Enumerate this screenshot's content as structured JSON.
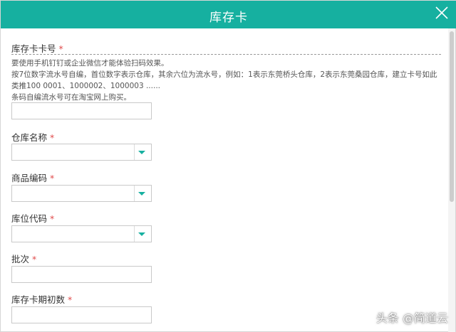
{
  "dialog": {
    "title": "库存卡",
    "close_icon": "close-icon"
  },
  "fields": {
    "card_no": {
      "label": "库存卡卡号",
      "required": "*",
      "help": [
        "要使用手机钉钉或企业微信才能体验扫码效果。",
        "按7位数字流水号自编，首位数字表示仓库，其余六位为流水号，例如：1表示东莞桥头仓库，2表示东莞桑园仓库，建立卡号如此类推100 0001、1000002、1000003 ......",
        "条码自编流水号可在淘宝网上购买。"
      ],
      "value": ""
    },
    "warehouse_name": {
      "label": "仓库名称",
      "required": "*",
      "value": ""
    },
    "product_code": {
      "label": "商品编码",
      "required": "*",
      "value": ""
    },
    "location_code": {
      "label": "库位代码",
      "required": "*",
      "value": ""
    },
    "batch": {
      "label": "批次",
      "required": "*",
      "value": ""
    },
    "opening_qty": {
      "label": "库存卡期初数",
      "required": "*",
      "value": ""
    }
  },
  "watermark": "头条 @简道云",
  "colors": {
    "header": "#16b0a0",
    "required": "#e04b4b",
    "dropdown_arrow": "#16b0a0"
  }
}
